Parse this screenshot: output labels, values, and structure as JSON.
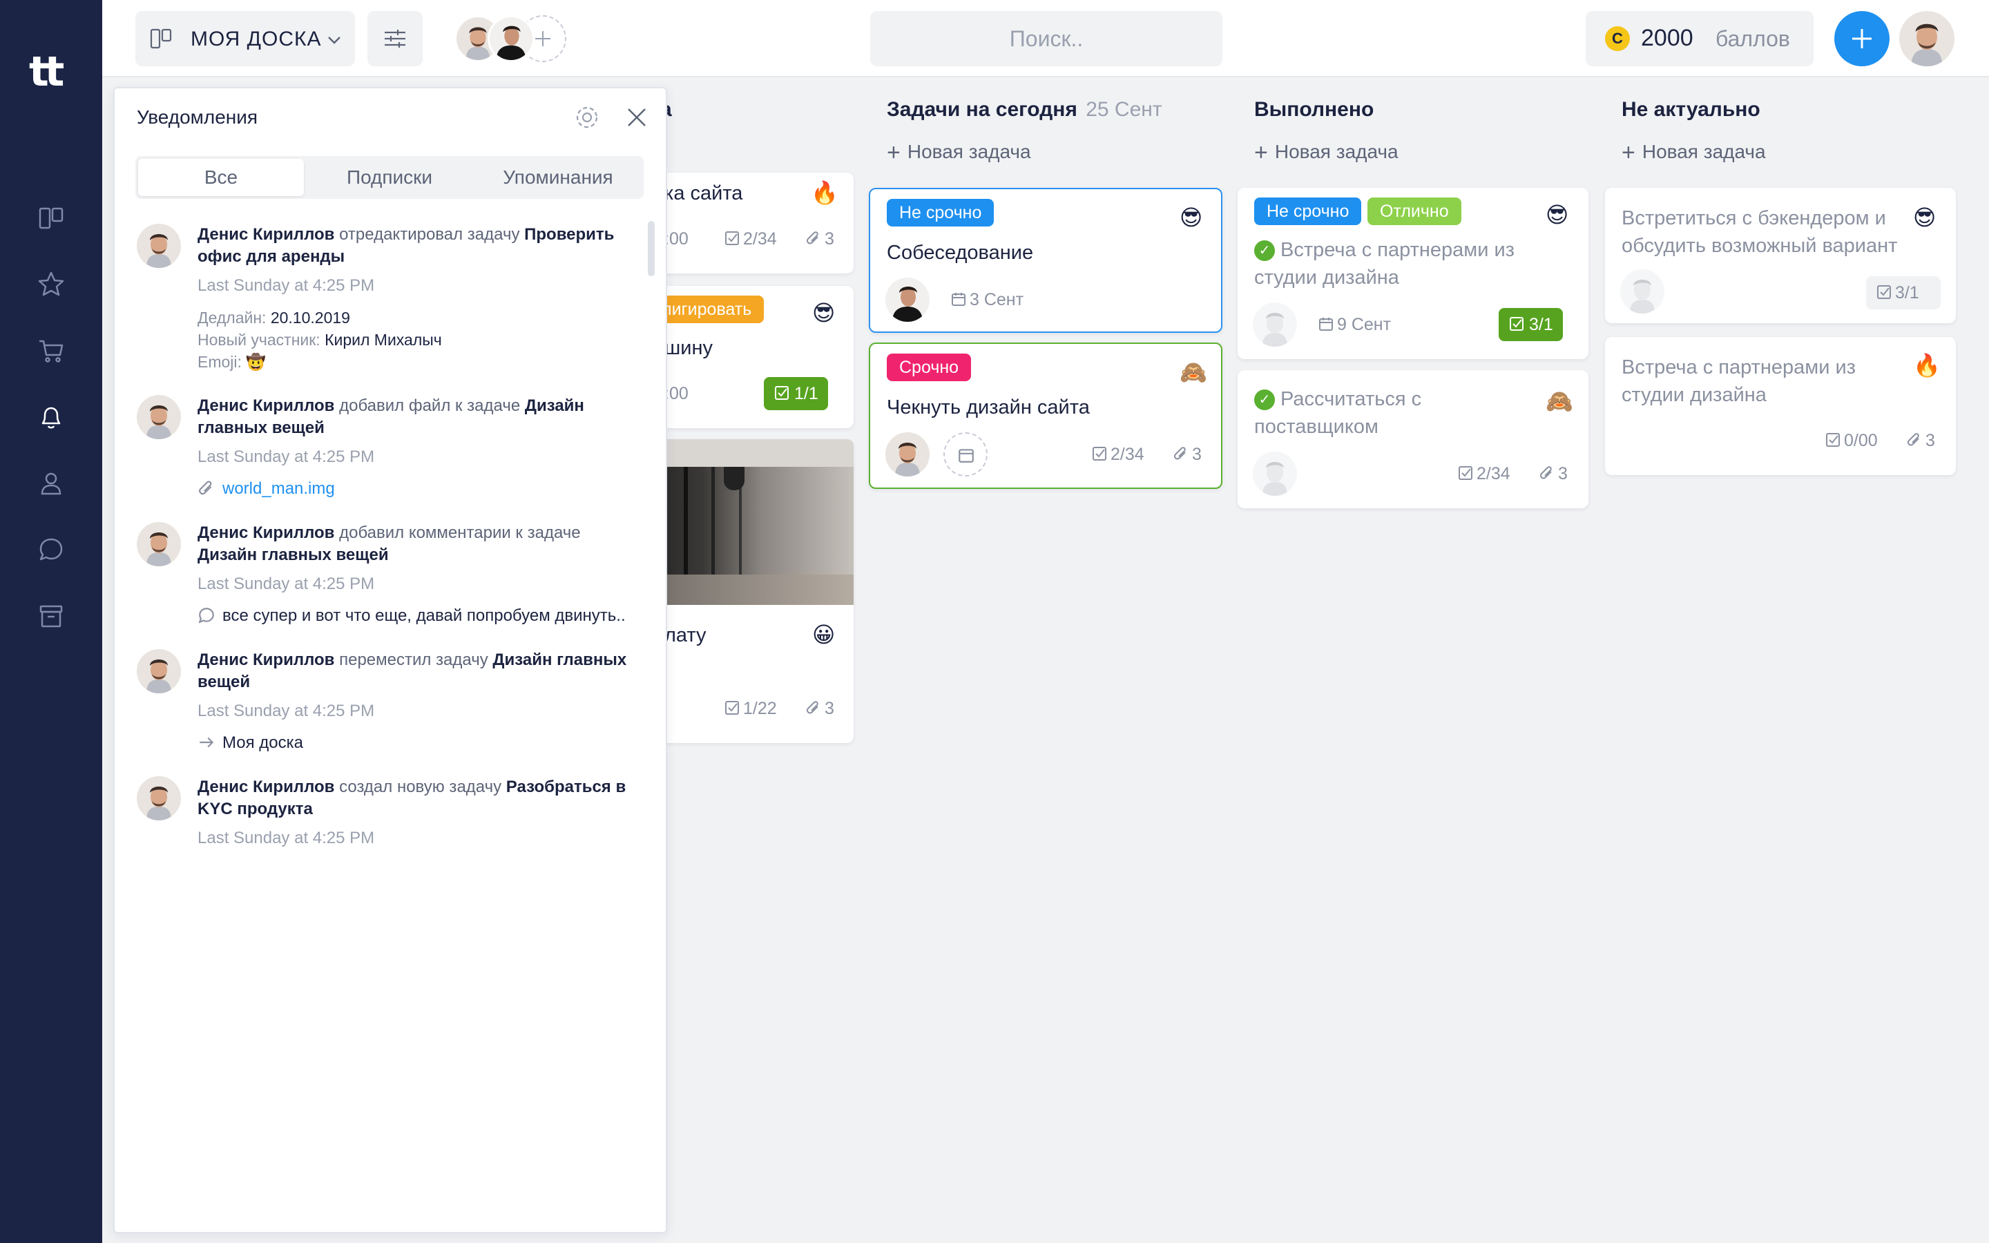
{
  "app": {
    "logo": "tt"
  },
  "rail": {
    "items": [
      {
        "icon": "board-icon"
      },
      {
        "icon": "star-icon"
      },
      {
        "icon": "cart-icon"
      },
      {
        "icon": "bell-icon"
      },
      {
        "icon": "user-icon"
      },
      {
        "icon": "chat-icon"
      },
      {
        "icon": "archive-icon"
      }
    ]
  },
  "topbar": {
    "board_name": "МОЯ ДОСКА",
    "search_placeholder": "Поиск..",
    "points_coin": "C",
    "points_value": "2000",
    "points_unit": "баллов"
  },
  "columns": {
    "partial": {
      "header_fragment": "а",
      "cards": [
        {
          "title": "ка сайта",
          "time": ":00",
          "checklist": "2/34",
          "attachments": "3",
          "emoji": "🔥"
        },
        {
          "tag": "лигировать",
          "title": "шину",
          "time": ":00",
          "done": "1/1",
          "emoji": "😎"
        },
        {
          "title": "лату",
          "checklist": "1/22",
          "attachments": "3",
          "emoji": "😀"
        }
      ]
    },
    "today": {
      "title": "Задачи на сегодня",
      "date": "25 Сент",
      "new_task": "Новая задача",
      "cards": [
        {
          "tag": "Не срочно",
          "title": "Собеседование",
          "date": "3 Сент",
          "emoji": "😎"
        },
        {
          "tag": "Срочно",
          "title": "Чекнуть дизайн сайта",
          "checklist": "2/34",
          "attachments": "3",
          "emoji": "🙈"
        }
      ]
    },
    "done": {
      "title": "Выполнено",
      "new_task": "Новая задача",
      "cards": [
        {
          "tags": [
            "Не срочно",
            "Отлично"
          ],
          "title": "Встреча с партнерами из студии дизайна",
          "date": "9 Сент",
          "done": "3/1",
          "emoji": "😎"
        },
        {
          "title": "Рассчитаться с поставщиком",
          "checklist": "2/34",
          "attachments": "3",
          "emoji": "🙈"
        }
      ]
    },
    "irrelevant": {
      "title": "Не актуально",
      "new_task": "Новая задача",
      "cards": [
        {
          "title": "Встретиться с бэкендером и обсудить возможный вариант",
          "checklist": "3/1",
          "emoji": "😎"
        },
        {
          "title": "Встреча с партнерами из студии дизайна",
          "checklist": "0/00",
          "attachments": "3",
          "emoji": "🔥"
        }
      ]
    }
  },
  "notifications": {
    "title": "Уведомления",
    "tabs": [
      "Все",
      "Подписки",
      "Упоминания"
    ],
    "items": [
      {
        "user": "Денис Кириллов",
        "action": "отредактировал задачу",
        "target": "Проверить офис для аренды",
        "time": "Last Sunday at 4:25 PM",
        "details": [
          {
            "label": "Дедлайн:",
            "value": "20.10.2019"
          },
          {
            "label": "Новый участник:",
            "value": "Кирил Михалыч"
          },
          {
            "label": "Emoji:",
            "value": "🤠"
          }
        ]
      },
      {
        "user": "Денис Кириллов",
        "action": "добавил файл к задаче",
        "target": "Дизайн главных вещей",
        "time": "Last Sunday at 4:25 PM",
        "attachment": "world_man.img"
      },
      {
        "user": "Денис Кириллов",
        "action": "добавил комментарии к задаче",
        "target": "Дизайн главных вещей",
        "time": "Last Sunday at 4:25 PM",
        "comment": "все супер и вот что еще, давай попробуем двинуть.."
      },
      {
        "user": "Денис  Кириллов",
        "action": "переместил задачу",
        "target": "Дизайн главных вещей",
        "time": "Last Sunday at 4:25 PM",
        "moved_to": "Моя доска"
      },
      {
        "user": "Денис Кириллов",
        "action": "создал новую задачу",
        "target": "Разобраться в KYC продукта",
        "time": "Last Sunday at 4:25 PM"
      }
    ]
  },
  "colors": {
    "sidebar": "#1b2445",
    "accent_blue": "#1e90f0",
    "urgent_pink": "#f0246e",
    "excellent_green": "#8dd14a",
    "done_green": "#57a31f",
    "tag_orange": "#f5a623",
    "coin_yellow": "#f5c518"
  }
}
